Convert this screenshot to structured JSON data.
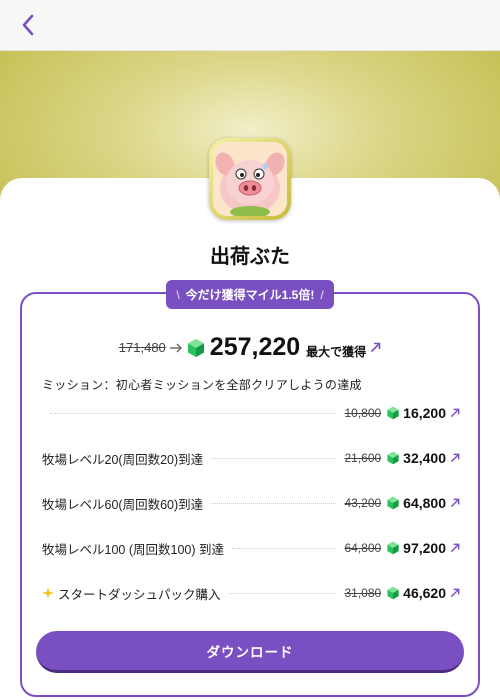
{
  "header": {
    "back_icon": "chevron-left-icon"
  },
  "app": {
    "title": "出荷ぶた",
    "icon": "pig-app-icon"
  },
  "colors": {
    "accent": "#7a4fc2",
    "gem": "#29c25a",
    "hero": "#d3cd70"
  },
  "badge": {
    "left": "\\",
    "text": "今だけ獲得マイル1.5倍!",
    "right": "/"
  },
  "reward": {
    "old_total": "171,480",
    "new_total": "257,220",
    "suffix": "最大で獲得"
  },
  "missions": {
    "intro": "ミッション：初心者ミッションを全部クリアしようの達成",
    "items": [
      {
        "label": "",
        "old": "10,800",
        "new": "16,200"
      },
      {
        "label": "牧場レベル20(周回数20)到達",
        "old": "21,600",
        "new": "32,400"
      },
      {
        "label": "牧場レベル60(周回数60)到達",
        "old": "43,200",
        "new": "64,800"
      },
      {
        "label": "牧場レベル100 (周回数100) 到達",
        "old": "64,800",
        "new": "97,200"
      },
      {
        "label": "スタートダッシュパック購入",
        "old": "31,080",
        "new": "46,620",
        "icon": "sparkle-icon"
      }
    ]
  },
  "download": {
    "label": "ダウンロード"
  }
}
